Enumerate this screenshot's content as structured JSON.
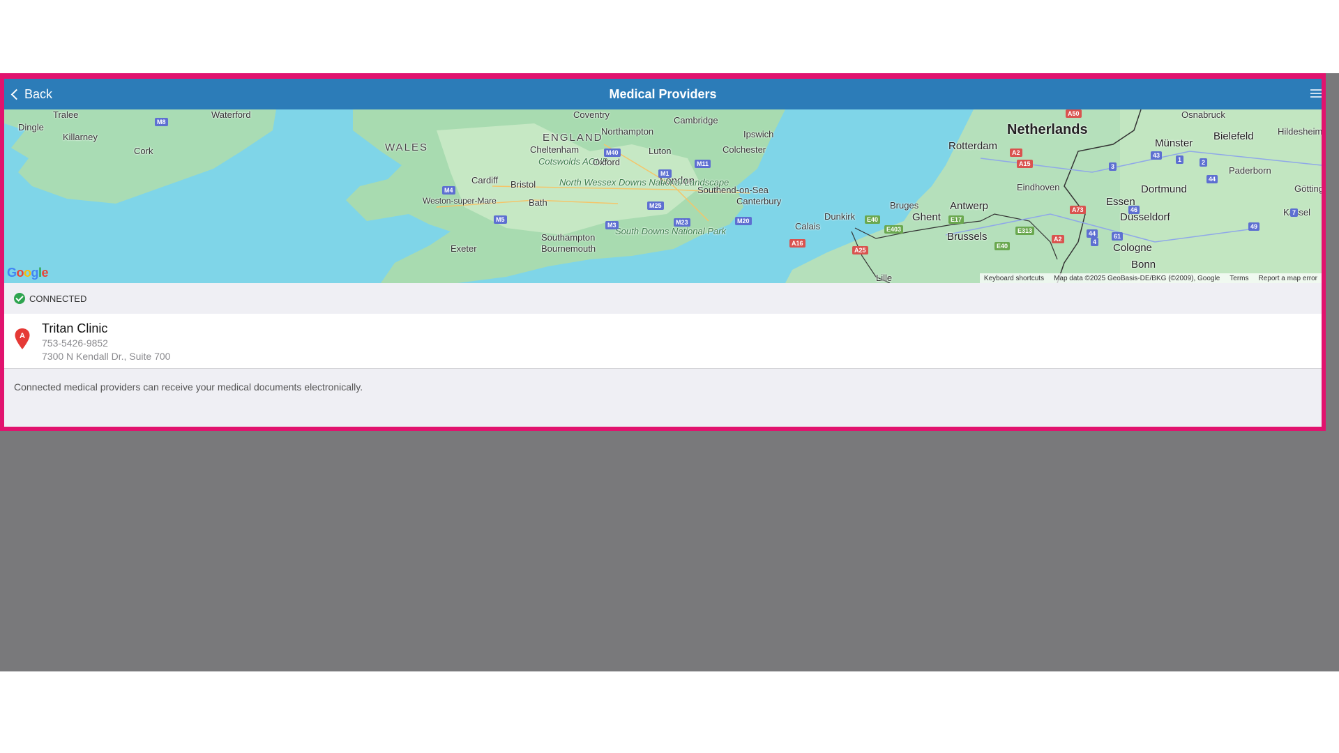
{
  "nav": {
    "back_label": "Back",
    "title": "Medical Providers"
  },
  "map": {
    "labels": {
      "tralee": "Tralee",
      "waterford": "Waterford",
      "dingle": "Dingle",
      "killarney": "Killarney",
      "cork": "Cork",
      "wales": "WALES",
      "england": "ENGLAND",
      "coventry": "Coventry",
      "northampton": "Northampton",
      "cambridge": "Cambridge",
      "ipswich": "Ipswich",
      "cheltenham": "Cheltenham",
      "luton": "Luton",
      "colchester": "Colchester",
      "cotswolds": "Cotswolds AONB",
      "oxford": "Oxford",
      "london": "London",
      "cardiff": "Cardiff",
      "bristol": "Bristol",
      "north_wessex": "North Wessex Downs National Landscape",
      "southend": "Southend-on-Sea",
      "canterbury": "Canterbury",
      "weston": "Weston-super-Mare",
      "bath": "Bath",
      "southampton": "Southampton",
      "bournemouth": "Bournemouth",
      "south_downs": "South Downs National Park",
      "exeter": "Exeter",
      "netherlands": "Netherlands",
      "rotterdam": "Rotterdam",
      "eindhoven": "Eindhoven",
      "antwerp": "Antwerp",
      "bruges": "Bruges",
      "ghent": "Ghent",
      "brussels": "Brussels",
      "calais": "Calais",
      "dunkirk": "Dunkirk",
      "lille": "Lille",
      "osnabruck": "Osnabruck",
      "munster": "Münster",
      "bielefeld": "Bielefeld",
      "hildesheim": "Hildesheim",
      "paderborn": "Paderborn",
      "dortmund": "Dortmund",
      "essen": "Essen",
      "dusseldorf": "Düsseldorf",
      "cologne": "Cologne",
      "bonn": "Bonn",
      "kassel": "Kassel",
      "gottingen": "Götting"
    },
    "shields": {
      "m8": "M8",
      "m40": "M40",
      "m11": "M11",
      "m1": "M1",
      "m4": "M4",
      "m25": "M25",
      "m5": "M5",
      "m23": "M23",
      "m20": "M20",
      "m3": "M3",
      "a50": "A50",
      "a2": "A2",
      "a15": "A15",
      "a73": "A73",
      "e40": "E40",
      "e17": "E17",
      "e403": "E403",
      "e313": "E313",
      "e40b": "E40",
      "a16": "A16",
      "a25": "A25",
      "a2b": "A2",
      "s1": "1",
      "s2": "2",
      "s3": "3",
      "s43": "43",
      "s44": "44",
      "s46": "46",
      "s61": "61",
      "s44b": "44",
      "s4": "4",
      "s49": "49",
      "s7": "7"
    },
    "attribution": {
      "shortcuts": "Keyboard shortcuts",
      "data": "Map data ©2025 GeoBasis-DE/BKG (©2009), Google",
      "terms": "Terms",
      "report": "Report a map error"
    }
  },
  "connected": {
    "label": "CONNECTED",
    "status_color": "#2ea44f"
  },
  "provider": {
    "pin_letter": "A",
    "name": "Tritan Clinic",
    "phone": "753-5426-9852",
    "address": "7300 N Kendall Dr., Suite 700"
  },
  "footer": {
    "note": "Connected medical providers can receive your medical documents electronically."
  },
  "colors": {
    "accent": "#2c7cb8",
    "highlight_border": "#e1136e",
    "pin": "#e53935"
  }
}
